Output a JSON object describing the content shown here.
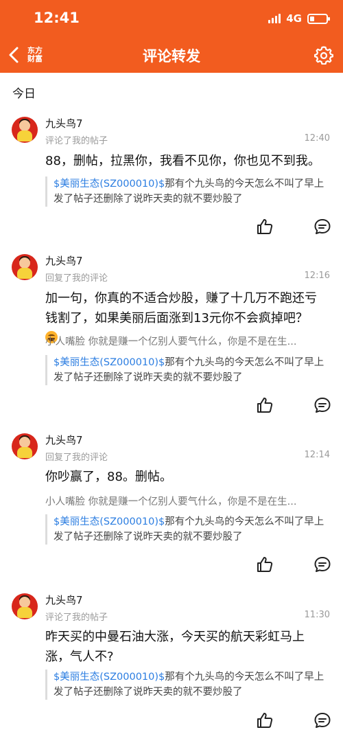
{
  "status_bar": {
    "time": "12:41",
    "network": "4G"
  },
  "header": {
    "logo": "东方\n财富",
    "title": "评论转发"
  },
  "section_title": "今日",
  "items": [
    {
      "username": "九头鸟7",
      "action": "评论了我的帖子",
      "time": "12:40",
      "content": "88，删帖，拉黑你，我看不见你，你也见不到我。",
      "sub": "",
      "quote_link": "$美丽生态(SZ000010)$",
      "quote_text": "那有个九头鸟的今天怎么不叫了早上发了帖子还删除了说昨天卖的就不要炒股了"
    },
    {
      "username": "九头鸟7",
      "action": "回复了我的评论",
      "time": "12:16",
      "content": "加一句，你真的不适合炒股，赚了十几万不跑还亏钱割了，如果美丽后面涨到13元你不会疯掉吧？",
      "sub": "小人嘴脸 你就是赚一个亿别人要气什么，你是不是在生...",
      "quote_link": "$美丽生态(SZ000010)$",
      "quote_text": "那有个九头鸟的今天怎么不叫了早上发了帖子还删除了说昨天卖的就不要炒股了"
    },
    {
      "username": "九头鸟7",
      "action": "回复了我的评论",
      "time": "12:14",
      "content": "你吵赢了，88。删帖。",
      "sub": "小人嘴脸 你就是赚一个亿别人要气什么，你是不是在生...",
      "quote_link": "$美丽生态(SZ000010)$",
      "quote_text": "那有个九头鸟的今天怎么不叫了早上发了帖子还删除了说昨天卖的就不要炒股了"
    },
    {
      "username": "九头鸟7",
      "action": "评论了我的帖子",
      "time": "11:30",
      "content": "昨天买的中曼石油大涨，今天买的航天彩虹马上涨，气人不?",
      "sub": "",
      "quote_link": "$美丽生态(SZ000010)$",
      "quote_text": "那有个九头鸟的今天怎么不叫了早上发了帖子还删除了说昨天卖的就不要炒股了"
    }
  ],
  "icons": [
    "back-arrow-icon",
    "gear-icon",
    "like-icon",
    "reply-icon",
    "signal-icon",
    "battery-icon",
    "grin-emoji-icon"
  ],
  "colors": {
    "brand": "#f25c1f",
    "link": "#2b7de1",
    "muted": "#9a9a9a"
  }
}
